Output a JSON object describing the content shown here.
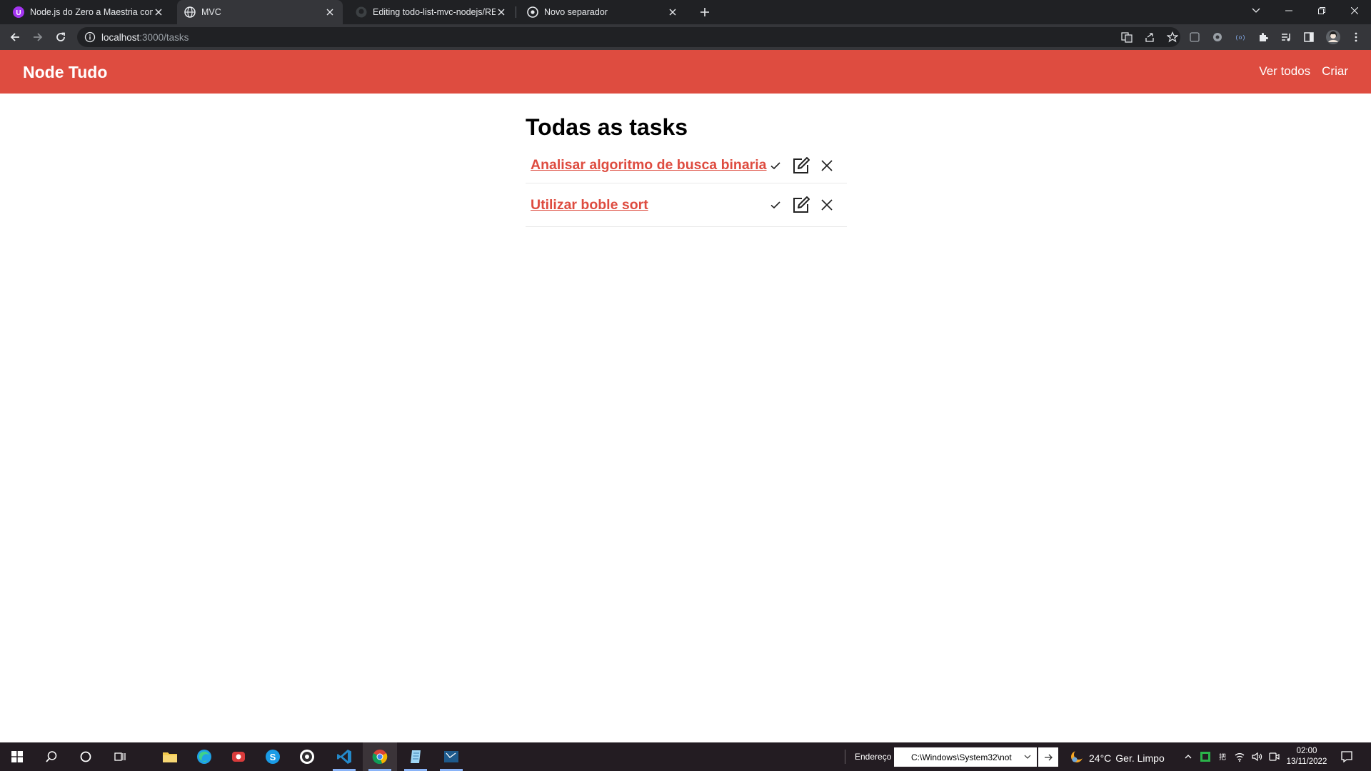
{
  "browser": {
    "tabs": [
      {
        "title": "Node.js do Zero a Maestria com",
        "active": false
      },
      {
        "title": "MVC",
        "active": true
      },
      {
        "title": "Editing todo-list-mvc-nodejs/REA",
        "active": false
      },
      {
        "title": "Novo separador",
        "active": false
      }
    ],
    "url_host": "localhost",
    "url_path": ":3000/tasks"
  },
  "navbar": {
    "brand": "Node Tudo",
    "links": [
      "Ver todos",
      "Criar"
    ],
    "color": "#de4c40"
  },
  "main": {
    "title": "Todas as tasks",
    "tasks": [
      {
        "title": "Analisar algoritmo de busca binaria"
      },
      {
        "title": "Utilizar boble sort"
      }
    ]
  },
  "taskbar": {
    "address_label": "Endereço",
    "address_value": "C:\\Windows\\System32\\not",
    "weather_temp": "24°C",
    "weather_desc": "Ger. Limpo",
    "time": "02:00",
    "date": "13/11/2022"
  }
}
